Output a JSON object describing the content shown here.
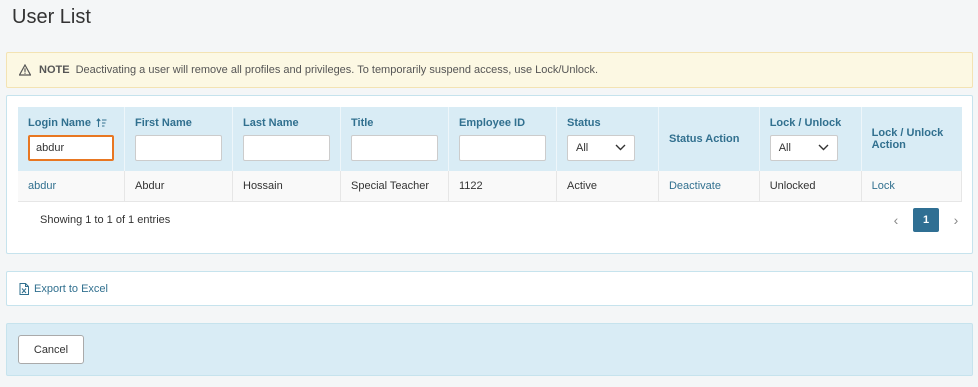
{
  "page": {
    "title": "User List"
  },
  "note": {
    "label": "NOTE",
    "text": "Deactivating a user will remove all profiles and privileges. To temporarily suspend access, use Lock/Unlock."
  },
  "table": {
    "headers": {
      "login_name": "Login Name",
      "first_name": "First Name",
      "last_name": "Last Name",
      "title": "Title",
      "employee_id": "Employee ID",
      "status": "Status",
      "status_action": "Status Action",
      "lock_unlock": "Lock / Unlock",
      "lock_unlock_action": "Lock / Unlock Action"
    },
    "filters": {
      "login_name": "abdur",
      "first_name": "",
      "last_name": "",
      "title": "",
      "employee_id": "",
      "status": "All",
      "lock_unlock": "All"
    },
    "rows": [
      {
        "login_name": "abdur",
        "first_name": "Abdur",
        "last_name": "Hossain",
        "title": "Special Teacher",
        "employee_id": "1122",
        "status": "Active",
        "status_action": "Deactivate",
        "lock_state": "Unlocked",
        "lock_action": "Lock"
      }
    ]
  },
  "footer": {
    "info": "Showing 1 to 1 of 1 entries",
    "prev": "‹",
    "current_page": "1",
    "next": "›"
  },
  "export": {
    "label": "Export to Excel"
  },
  "actions": {
    "cancel": "Cancel"
  },
  "colors": {
    "accent": "#31708f",
    "header_bg": "#d9ecf5",
    "focus_border": "#e87722",
    "note_bg": "#fcf8e3",
    "page_active": "#2f6f93"
  }
}
